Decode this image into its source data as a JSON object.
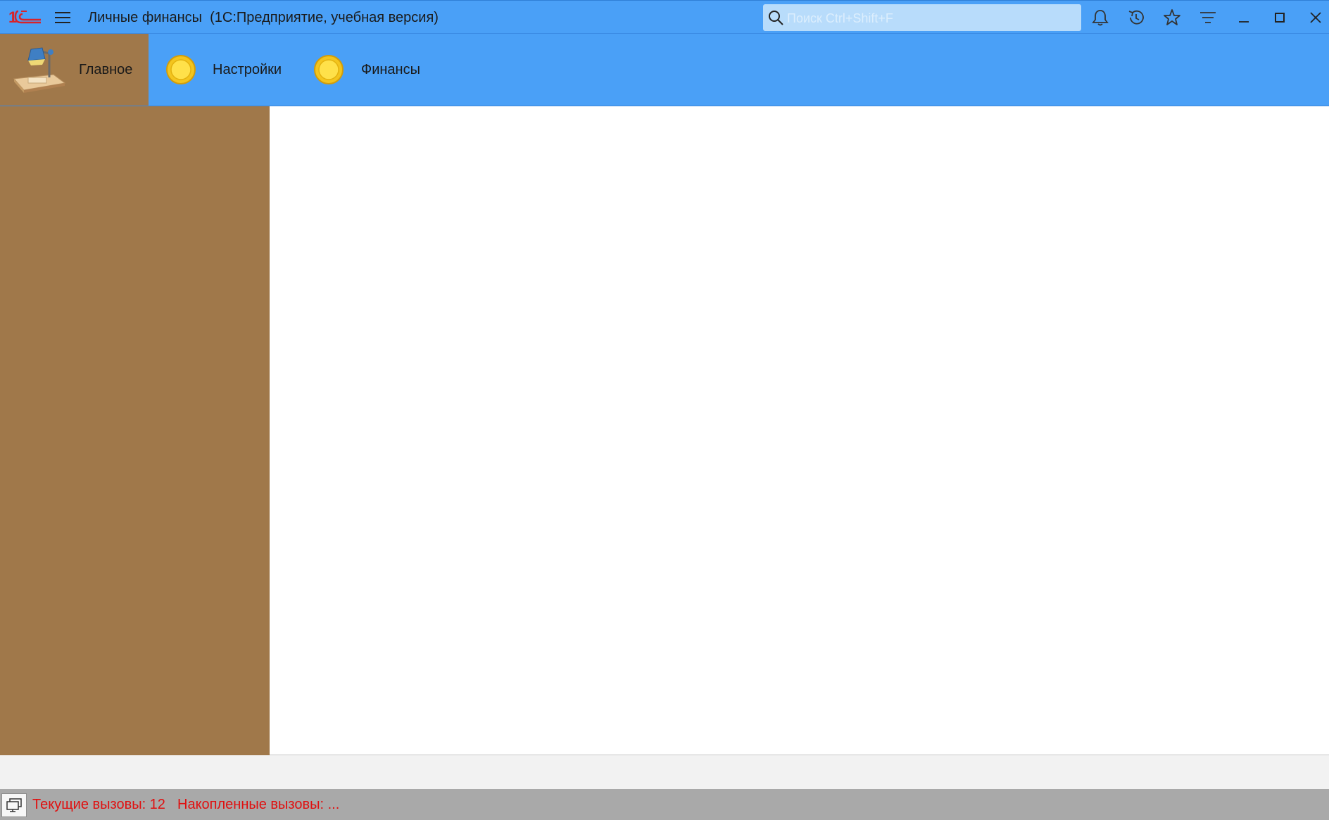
{
  "window": {
    "title": "Личные финансы  (1С:Предприятие, учебная версия)",
    "logo_icon": "1c-logo",
    "menu_icon": "hamburger-menu-icon"
  },
  "search": {
    "placeholder": "Поиск Ctrl+Shift+F"
  },
  "toolbar": {
    "icons": [
      "bell-icon",
      "history-icon",
      "star-icon",
      "filter-icon",
      "minimize-icon",
      "maximize-icon",
      "close-icon"
    ]
  },
  "sections": [
    {
      "label": "Главное",
      "icon": "desk-lamp-icon",
      "active": true
    },
    {
      "label": "Настройки",
      "icon": "yellow-circle-icon",
      "active": false
    },
    {
      "label": "Финансы",
      "icon": "yellow-circle-icon",
      "active": false
    }
  ],
  "status": {
    "current_calls": "Текущие вызовы: 12",
    "accumulated_calls": "Накопленные вызовы: ..."
  },
  "colors": {
    "titlebar": "#4aa0f7",
    "sidebar": "#a0784a",
    "status_text": "#e01010",
    "statusbar": "#a9a9a9"
  }
}
